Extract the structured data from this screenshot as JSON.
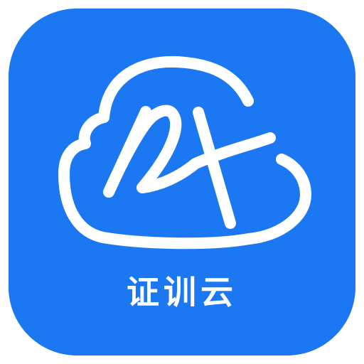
{
  "app": {
    "name": "证训云",
    "icon_name": "cloud-logo-icon"
  },
  "colors": {
    "background": "#1B78F2",
    "glyph": "#FFFFFF",
    "page": "#FFFFFF"
  }
}
